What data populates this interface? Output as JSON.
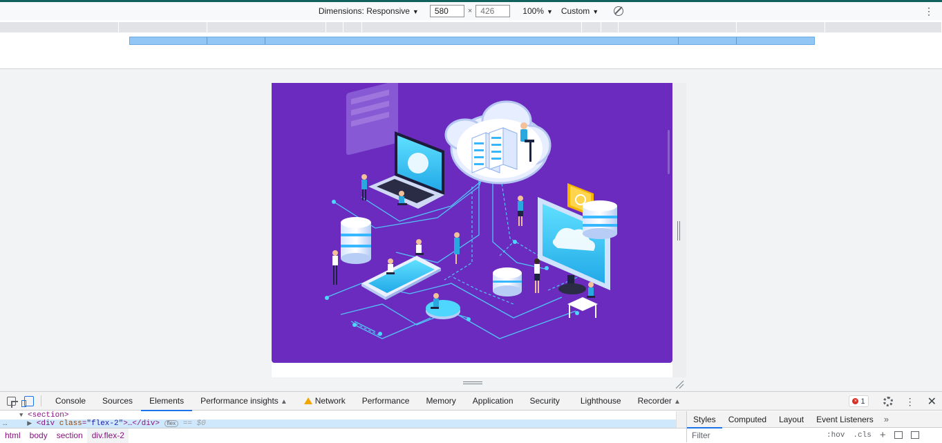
{
  "device_toolbar": {
    "dimensions_label": "Dimensions: Responsive",
    "width_value": "580",
    "height_placeholder": "426",
    "times": "×",
    "zoom_label": "100%",
    "throttle_label": "Custom",
    "caret": "▼",
    "more": "⋮"
  },
  "devtools": {
    "tabs": [
      {
        "label": "Console"
      },
      {
        "label": "Sources"
      },
      {
        "label": "Elements"
      },
      {
        "label": "Performance insights"
      },
      {
        "label": "Network"
      },
      {
        "label": "Performance"
      },
      {
        "label": "Memory"
      },
      {
        "label": "Application"
      },
      {
        "label": "Security"
      },
      {
        "label": "Lighthouse"
      },
      {
        "label": "Recorder"
      }
    ],
    "active_tab": "Elements",
    "error_count": "1",
    "error_glyph": "×",
    "more": "⋮",
    "close": "✕",
    "flask": "▲",
    "dom": {
      "line1_tag": "<section>",
      "line2_open": "<div ",
      "line2_attr_name": "class",
      "line2_attr_eq": "=",
      "line2_attr_value": "\"flex-2\"",
      "line2_close": ">…</div>",
      "line2_badge": "flex",
      "line2_suffix": "== $0",
      "expand_down": "▼",
      "expand_right": "▶",
      "dots": "…"
    },
    "breadcrumbs": [
      "html",
      "body",
      "section",
      "div.flex-2"
    ],
    "styles": {
      "tabs": [
        "Styles",
        "Computed",
        "Layout",
        "Event Listeners"
      ],
      "more": "»",
      "filter_placeholder": "Filter",
      "hov": ":hov",
      "cls": ".cls",
      "plus": "+"
    }
  },
  "colors": {
    "hero_bg": "#6b2bbf",
    "accent": "#1a73e8",
    "media_query_bar": "#92c6f5"
  },
  "hero_illustration": "isometric cloud computing network illustration"
}
